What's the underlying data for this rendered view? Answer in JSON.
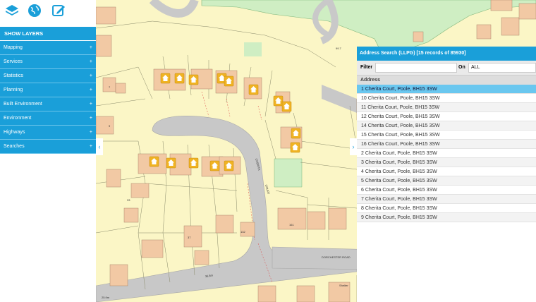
{
  "sidebar": {
    "header": "SHOW LAYERS",
    "items": [
      {
        "label": "Mapping"
      },
      {
        "label": "Services"
      },
      {
        "label": "Statistics"
      },
      {
        "label": "Planning"
      },
      {
        "label": "Built Environment"
      },
      {
        "label": "Environment"
      },
      {
        "label": "Highways"
      },
      {
        "label": "Searches"
      }
    ],
    "plus": "+"
  },
  "toolbar": {
    "icons": [
      "layers-icon",
      "globe-icon",
      "edit-icon"
    ]
  },
  "map": {
    "labels": {
      "road_1": "CHERITA",
      "road_2": "COURT",
      "dorchester": "DORCHESTER ROAD",
      "shelter": "Shelter",
      "house_161": "161",
      "house_132": "132",
      "house_33": "33",
      "house_37": "37",
      "house_7": "7",
      "house_9": "9",
      "spot_elev": "36.8m",
      "spot_elev2": "25.9m",
      "ref_99": "99.7"
    }
  },
  "collapse_icons": {
    "left": "‹",
    "right": "›"
  },
  "address_search": {
    "title": "Address Search (LLPG) [15 records of 85930]",
    "filter_label": "Filter",
    "filter_value": "",
    "on_label": "On",
    "on_value": "ALL",
    "column": "Address",
    "rows": [
      "1 Cherita Court, Poole, BH15 3SW",
      "10 Cherita Court, Poole, BH15 3SW",
      "11 Cherita Court, Poole, BH15 3SW",
      "12 Cherita Court, Poole, BH15 3SW",
      "14 Cherita Court, Poole, BH15 3SW",
      "15 Cherita Court, Poole, BH15 3SW",
      "16 Cherita Court, Poole, BH15 3SW",
      "2 Cherita Court, Poole, BH15 3SW",
      "3 Cherita Court, Poole, BH15 3SW",
      "4 Cherita Court, Poole, BH15 3SW",
      "5 Cherita Court, Poole, BH15 3SW",
      "6 Cherita Court, Poole, BH15 3SW",
      "7 Cherita Court, Poole, BH15 3SW",
      "8 Cherita Court, Poole, BH15 3SW",
      "9 Cherita Court, Poole, BH15 3SW"
    ],
    "selected_index": 0
  },
  "colors": {
    "accent": "#1a9fd9",
    "selected_row": "#6ac7ef",
    "map_bg": "#fbf6c6",
    "green_space": "#cdebc0",
    "road": "#c8c8c8",
    "marker": "#f0b323"
  }
}
